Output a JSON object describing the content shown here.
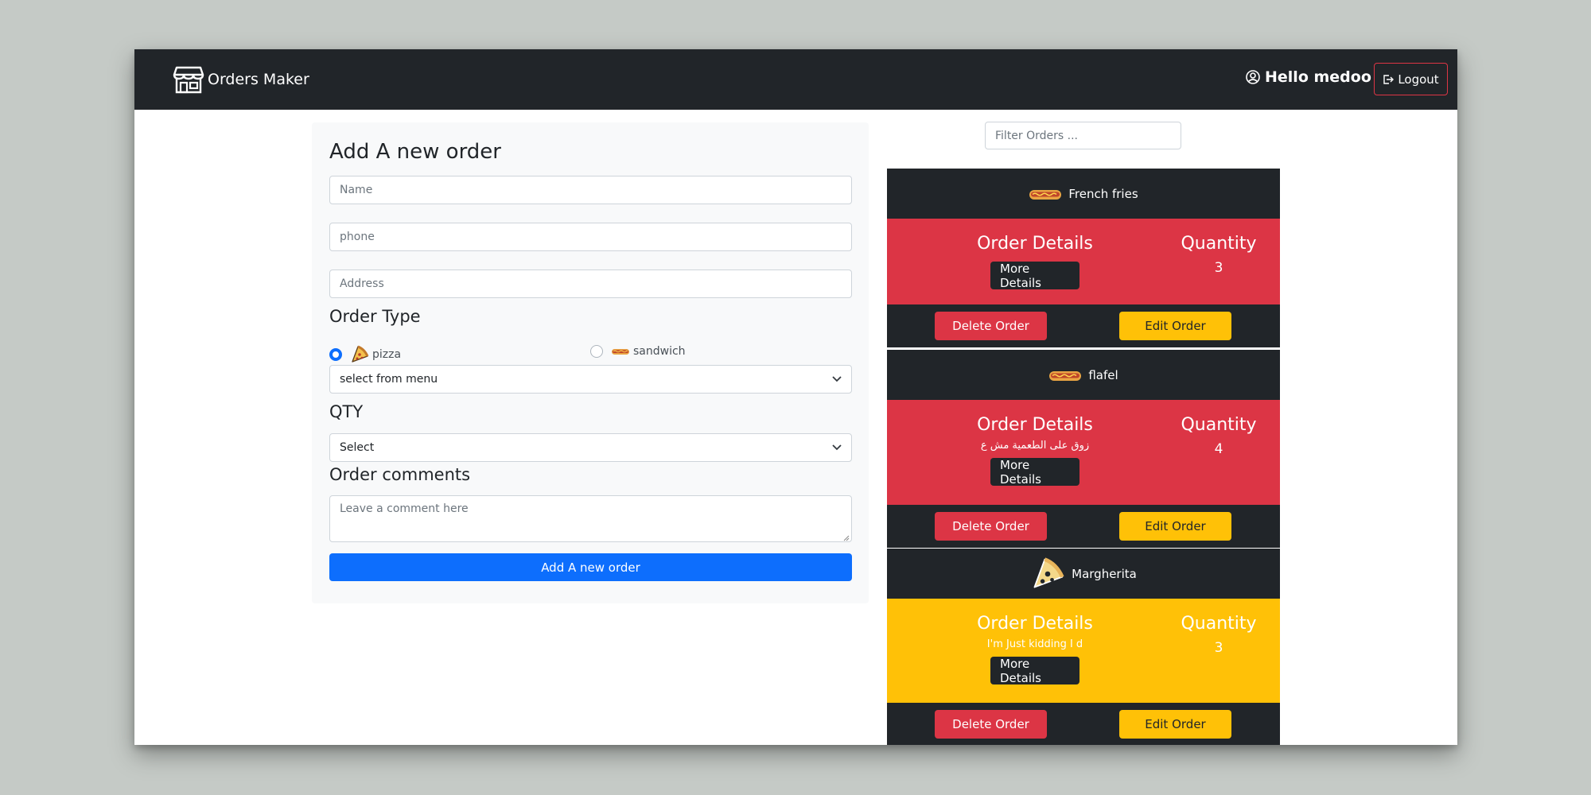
{
  "navbar": {
    "brand": "Orders Maker",
    "greeting": "Hello medoo",
    "logout_label": "Logout"
  },
  "form": {
    "title": "Add A new order",
    "name_placeholder": "Name",
    "phone_placeholder": "phone",
    "address_placeholder": "Address",
    "order_type_label": "Order Type",
    "type_options": [
      {
        "label": "pizza",
        "checked": true,
        "icon": "pizza-icon"
      },
      {
        "label": "sandwich",
        "checked": false,
        "icon": "hotdog-icon"
      }
    ],
    "menu_select": "select from menu",
    "qty_label": "QTY",
    "qty_select": "Select",
    "comments_label": "Order comments",
    "comment_placeholder": "Leave a comment here",
    "submit_label": "Add A new order"
  },
  "filter": {
    "placeholder": "Filter Orders ..."
  },
  "orders": [
    {
      "name": "French fries",
      "icon": "hotdog-icon",
      "details_label": "Order Details",
      "comment": "",
      "more_label": "More Details",
      "qty_label": "Quantity",
      "qty": "3",
      "color": "#dc3545",
      "delete_label": "Delete Order",
      "edit_label": "Edit Order"
    },
    {
      "name": "flafel",
      "icon": "hotdog-icon",
      "details_label": "Order Details",
      "comment": "زوق على الطعمية مش ع",
      "more_label": "More Details",
      "qty_label": "Quantity",
      "qty": "4",
      "color": "#dc3545",
      "delete_label": "Delete Order",
      "edit_label": "Edit Order"
    },
    {
      "name": "Margherita",
      "icon": "pizza-icon",
      "details_label": "Order Details",
      "comment": "I'm Just kidding I d",
      "more_label": "More Details",
      "qty_label": "Quantity",
      "qty": "3",
      "color": "#ffc107",
      "delete_label": "Delete Order",
      "edit_label": "Edit Order"
    }
  ]
}
